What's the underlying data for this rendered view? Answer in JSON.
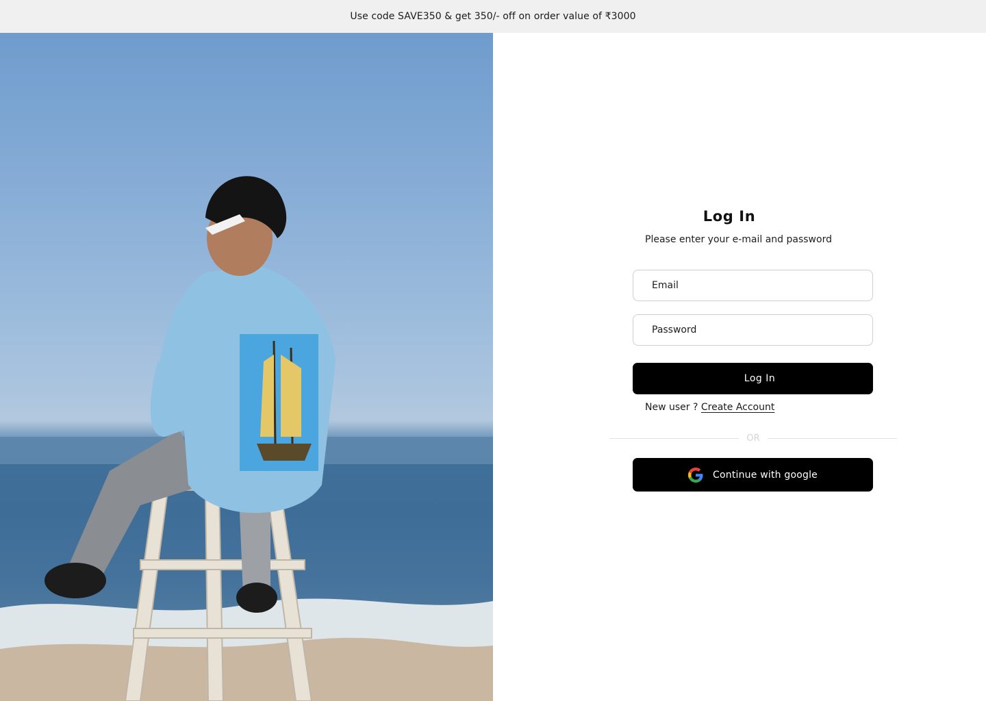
{
  "promo": {
    "text": "Use code SAVE350 & get 350/- off on order value of ₹3000"
  },
  "hero": {
    "image_alt": "Man in light blue ship-print oversized t-shirt sitting on a wooden stool by the sea"
  },
  "login": {
    "title": "Log In",
    "subtitle": "Please enter your e-mail and password",
    "email_placeholder": "Email",
    "password_placeholder": "Password",
    "submit_label": "Log In",
    "new_user_text": "New user ? ",
    "create_account_label": "Create Account",
    "or_label": "OR",
    "google_label": "Continue with google"
  },
  "colors": {
    "button_bg": "#000000",
    "promo_bg": "#f0f0f0",
    "input_border": "#cfcfcf"
  },
  "icons": {
    "google": "google-g-icon"
  }
}
